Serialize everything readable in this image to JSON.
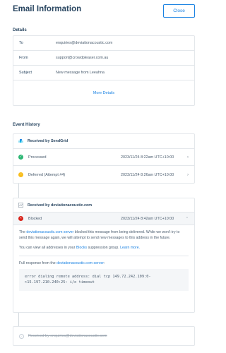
{
  "header": {
    "title": "Email Information",
    "close_label": "Close"
  },
  "details": {
    "section_label": "Details",
    "rows": [
      {
        "label": "To",
        "value": "enquiries@deviationacoustic.com"
      },
      {
        "label": "From",
        "value": "support@crowdpleaser.com.au"
      },
      {
        "label": "Subject",
        "value": "New message from Leeahna"
      }
    ],
    "more_label": "More Details"
  },
  "event_history": {
    "section_label": "Event History",
    "sendgrid": {
      "title": "Received by SendGrid",
      "events": [
        {
          "name": "Processed",
          "time": "2023/11/24 8:22am UTC+10:00",
          "status": "success",
          "status_color": "#2bb673"
        },
        {
          "name": "Deferred (Attempt #4)",
          "time": "2023/11/24 8:26am UTC+10:00",
          "status": "warning",
          "status_color": "#f8bd1c"
        }
      ]
    },
    "recipient": {
      "title": "Received by deviationacoustic.com",
      "blocked": {
        "name": "Blocked",
        "time": "2023/11/24 8:42am UTC+10:00",
        "status_color": "#d8221a"
      },
      "message_pre": "The ",
      "server_link": "deviationacoustic.com server",
      "message_post": " blocked this message from being delivered. While we won't try to send this message again, we will attempt to send new messages to this address in the future.",
      "view_pre": "You can view all addresses in your ",
      "blocks_link": "Blocks",
      "view_mid": " suppression group. ",
      "learn_more": "Learn more.",
      "response_pre": "Full response from the ",
      "response_link": "deviationacoustic.com server",
      "response_post": ":",
      "response_line1": "error dialing remote address: dial tcp 149.72.242.109:0-",
      "response_line2": ">15.197.210.240:25: i/o timeout"
    },
    "pending": {
      "label": "Received by enquiries@deviationacoustic.com"
    }
  },
  "colors": {
    "accent": "#1a82e2",
    "text": "#294661",
    "border": "#e3e7eb"
  }
}
